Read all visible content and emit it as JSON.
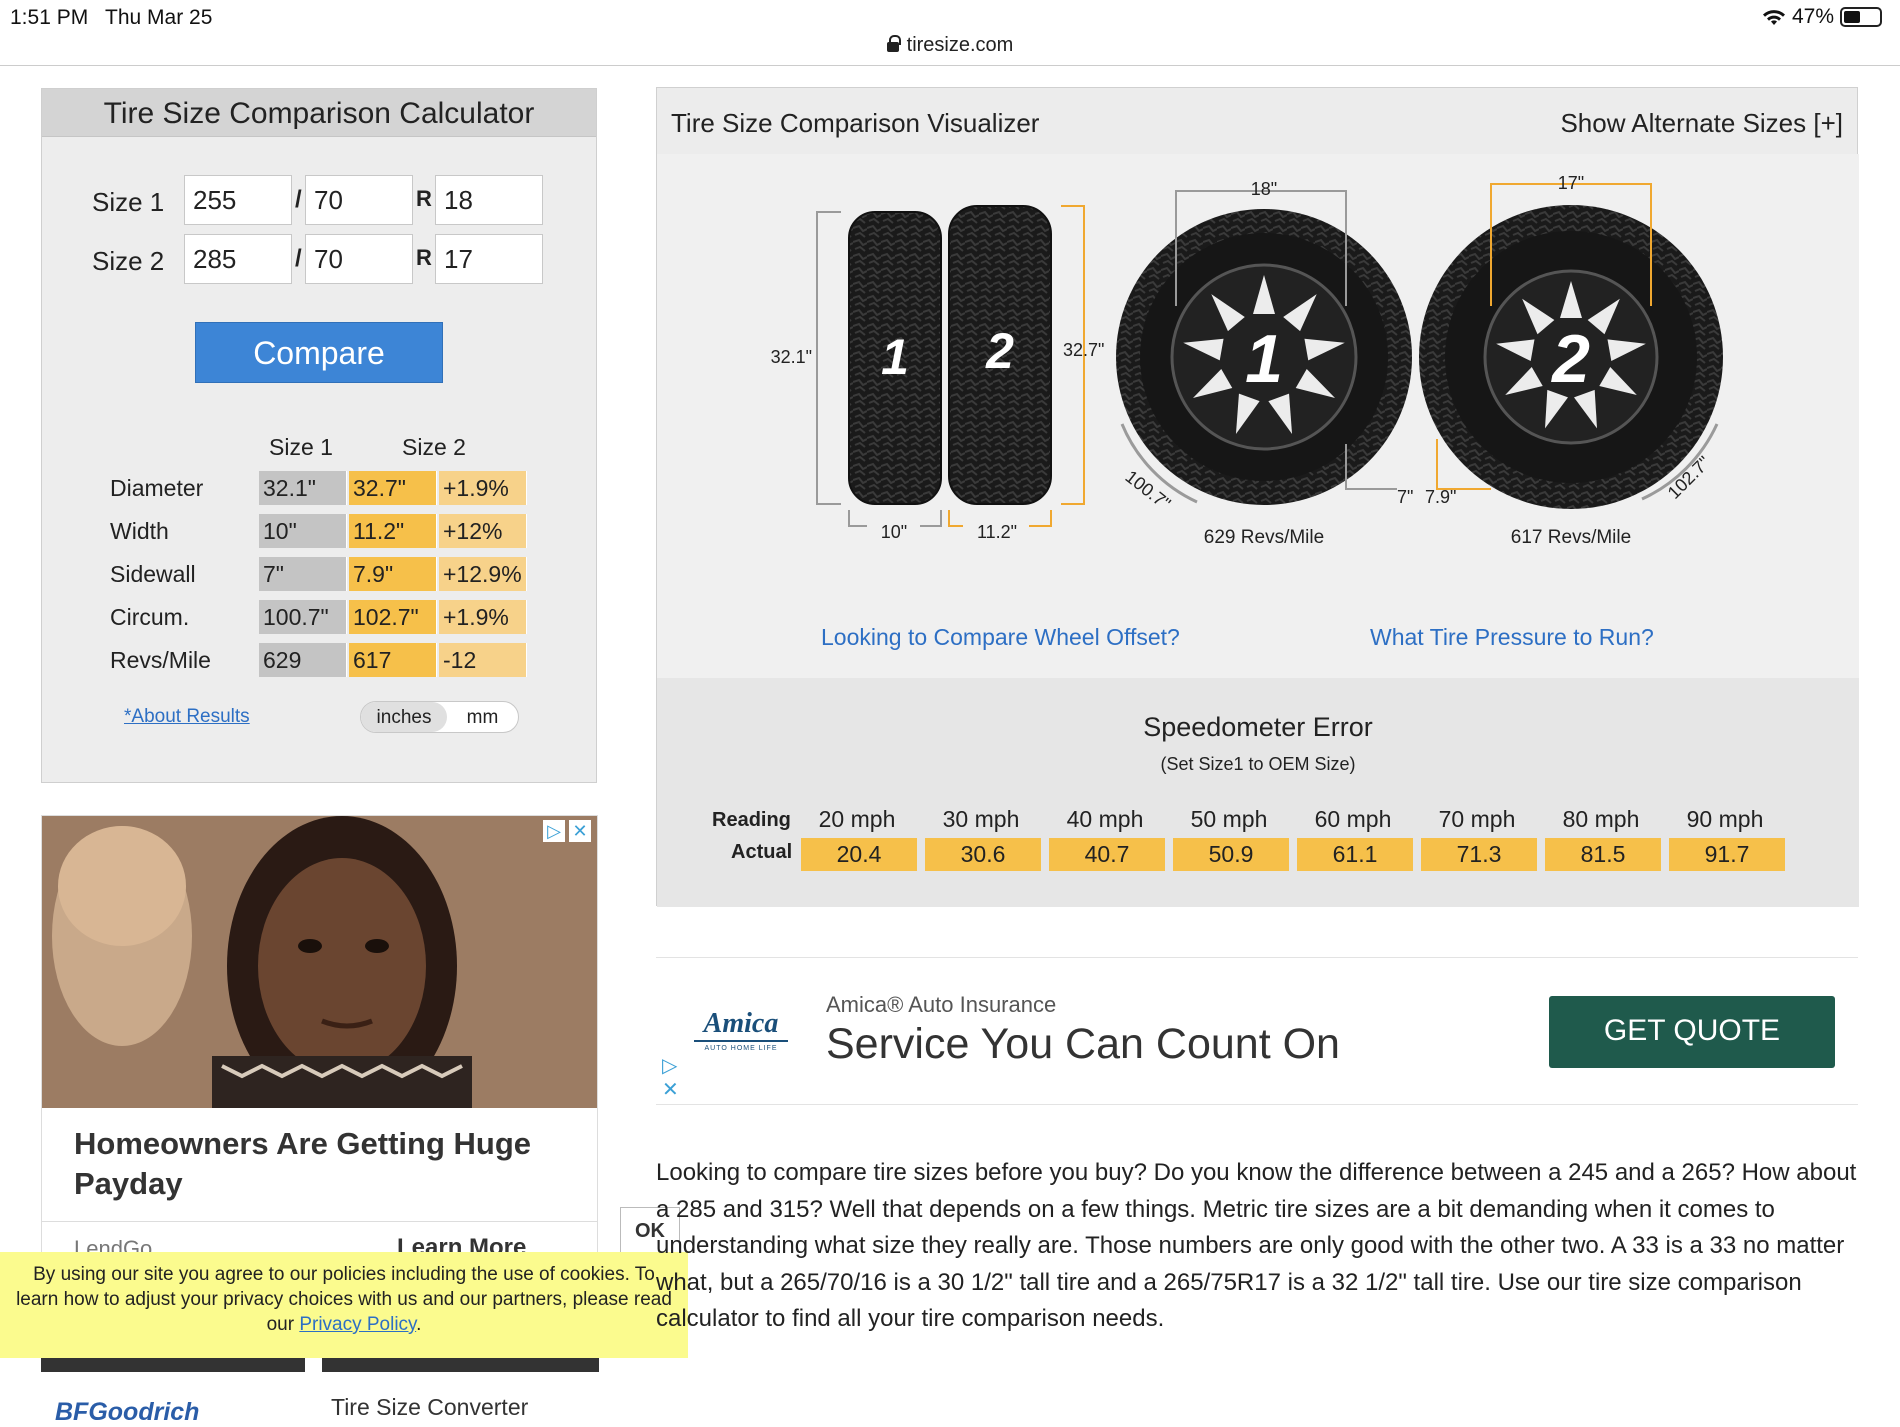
{
  "status": {
    "time": "1:51 PM",
    "date": "Thu Mar 25",
    "battery": "47%",
    "battery_level": 0.47
  },
  "browser": {
    "url": "tiresize.com"
  },
  "calculator": {
    "title": "Tire Size Comparison Calculator",
    "size1": {
      "label": "Size 1",
      "width": "255",
      "aspect": "70",
      "rim": "18"
    },
    "size2": {
      "label": "Size 2",
      "width": "285",
      "aspect": "70",
      "rim": "17"
    },
    "slash": "/",
    "r": "R",
    "compare_label": "Compare",
    "results_header": {
      "size1": "Size 1",
      "size2": "Size 2"
    },
    "results": [
      {
        "label": "Diameter",
        "s1": "32.1\"",
        "s2": "32.7\"",
        "diff": "+1.9%"
      },
      {
        "label": "Width",
        "s1": "10\"",
        "s2": "11.2\"",
        "diff": "+12%"
      },
      {
        "label": "Sidewall",
        "s1": "7\"",
        "s2": "7.9\"",
        "diff": "+12.9%"
      },
      {
        "label": "Circum.",
        "s1": "100.7\"",
        "s2": "102.7\"",
        "diff": "+1.9%"
      },
      {
        "label": "Revs/Mile",
        "s1": "629",
        "s2": "617",
        "diff": "-12"
      }
    ],
    "about_link": "*About Results",
    "units": {
      "inches": "inches",
      "mm": "mm",
      "selected": "inches"
    }
  },
  "visualizer": {
    "title": "Tire Size Comparison Visualizer",
    "alt_sizes": "Show Alternate Sizes [+]",
    "side": {
      "h1": "32.1\"",
      "h2": "32.7\"",
      "w1": "10\"",
      "w2": "11.2\"",
      "n1": "1",
      "n2": "2"
    },
    "wheel1": {
      "rim": "18\"",
      "circ": "100.7\"",
      "sidewall": "7\"",
      "revs": "629 Revs/Mile",
      "n": "1"
    },
    "wheel2": {
      "rim": "17\"",
      "circ": "102.7\"",
      "sidewall": "7.9\"",
      "revs": "617 Revs/Mile",
      "n": "2"
    },
    "link_offset": "Looking to Compare Wheel Offset?",
    "link_pressure": "What Tire Pressure to Run?",
    "colors": {
      "tire1": "#9a9a9a",
      "tire2": "#f0a830"
    }
  },
  "speedometer": {
    "title": "Speedometer Error",
    "subtitle": "(Set Size1 to OEM Size)",
    "reading_label": "Reading",
    "actual_label": "Actual",
    "readings": [
      "20 mph",
      "30 mph",
      "40 mph",
      "50 mph",
      "60 mph",
      "70 mph",
      "80 mph",
      "90 mph"
    ],
    "actual": [
      "20.4",
      "30.6",
      "40.7",
      "50.9",
      "61.1",
      "71.3",
      "81.5",
      "91.7"
    ]
  },
  "ad_left": {
    "headline": "Homeowners Are Getting Huge Payday",
    "sponsor": "LendGo",
    "cta": "Learn More"
  },
  "cookie": {
    "ok": "OK",
    "text": "By using our site you agree to our policies including the use of cookies. To learn how to adjust your privacy choices with us and our partners, please read our",
    "link": "Privacy Policy",
    "end": "."
  },
  "ad_amica": {
    "brand": "Amica",
    "tagline_small": "AUTO  HOME  LIFE",
    "sub": "Amica® Auto Insurance",
    "headline": "Service You Can Count On",
    "cta": "GET QUOTE"
  },
  "article": {
    "text": "Looking to compare tire sizes before you buy? Do you know the difference between a 245 and a 265? How about a 285 and 315? Well that depends on a few things. Metric tire sizes are a bit demanding when it comes to understanding what size they really are. Those numbers are only good with the other two. A 33 is a 33 no matter what, but a 265/70/16 is a 30 1/2\" tall tire and a 265/75R17 is a 32 1/2\" tall tire. Use our tire size comparison calculator to find all your tire comparison needs."
  },
  "bottom": {
    "bfg": "BFGoodrich",
    "converter": "Tire Size Converter"
  }
}
